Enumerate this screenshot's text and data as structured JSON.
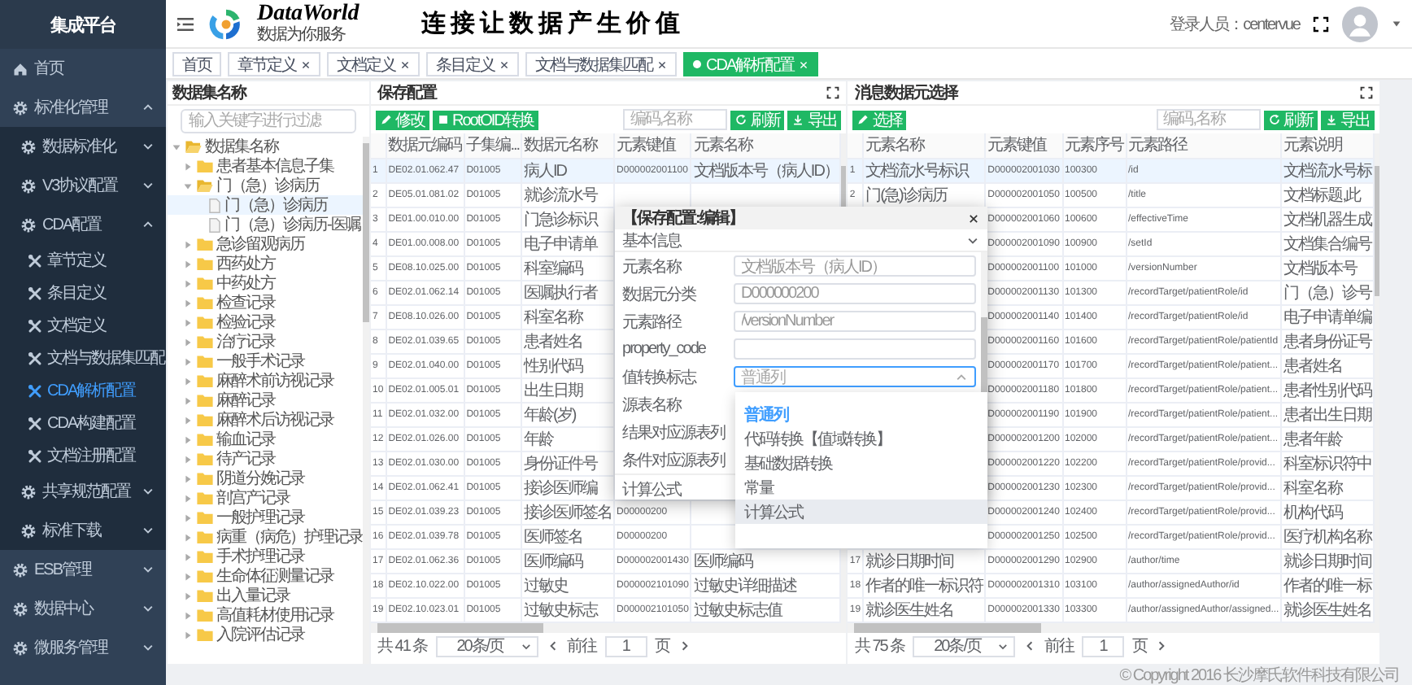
{
  "sidebar": {
    "title": "集成平台",
    "items": [
      {
        "label": "首页"
      },
      {
        "label": "标准化管理",
        "expanded": true,
        "children": [
          {
            "label": "数据标准化",
            "expanded": false
          },
          {
            "label": "V3协议配置",
            "expanded": false
          },
          {
            "label": "CDA配置",
            "expanded": true,
            "children": [
              {
                "label": "章节定义",
                "selected": false
              },
              {
                "label": "条目定义",
                "selected": false
              },
              {
                "label": "文档定义",
                "selected": false
              },
              {
                "label": "文档与数据集匹配",
                "selected": false
              },
              {
                "label": "CDA解析配置",
                "selected": true
              },
              {
                "label": "CDA构建配置",
                "selected": false
              },
              {
                "label": "文档注册配置",
                "selected": false
              }
            ]
          },
          {
            "label": "共享规范配置",
            "expanded": false
          },
          {
            "label": "标准下载",
            "expanded": false
          }
        ]
      },
      {
        "label": "ESB管理",
        "expanded": false
      },
      {
        "label": "数据中心",
        "expanded": false
      },
      {
        "label": "微服务管理",
        "expanded": false
      }
    ]
  },
  "header": {
    "logo_text": "DataWorld",
    "logo_subtitle": "数据为你服务",
    "slogan": "连接让数据产生价值",
    "user_label": "登录人员：centervue"
  },
  "tabs": [
    {
      "label": "首页",
      "closable": false,
      "selected": false
    },
    {
      "label": "章节定义",
      "closable": true,
      "selected": false
    },
    {
      "label": "文档定义",
      "closable": true,
      "selected": false
    },
    {
      "label": "条目定义",
      "closable": true,
      "selected": false
    },
    {
      "label": "文档与数据集匹配",
      "closable": true,
      "selected": false
    },
    {
      "label": "CDA解析配置",
      "closable": true,
      "selected": true
    }
  ],
  "tree_panel": {
    "title": "数据集名称",
    "search": {
      "placeholder": "输入关键字进行过滤"
    },
    "nodes": [
      {
        "label": "数据集名称",
        "kind": "folder",
        "expanded": true,
        "selected": false,
        "children": [
          {
            "label": "患者基本信息子集",
            "kind": "folder",
            "expanded": false,
            "selected": false
          },
          {
            "label": "门（急）诊病历",
            "kind": "folder",
            "expanded": true,
            "selected": false,
            "children": [
              {
                "label": "门（急）诊病历",
                "kind": "file",
                "selected": true
              },
              {
                "label": "门（急）诊病历-医嘱",
                "kind": "file",
                "selected": false
              }
            ]
          },
          {
            "label": "急诊留观病历",
            "kind": "folder",
            "expanded": false,
            "selected": false
          },
          {
            "label": "西药处方",
            "kind": "folder",
            "expanded": false,
            "selected": false
          },
          {
            "label": "中药处方",
            "kind": "folder",
            "expanded": false,
            "selected": false
          },
          {
            "label": "检查记录",
            "kind": "folder",
            "expanded": false,
            "selected": false
          },
          {
            "label": "检验记录",
            "kind": "folder",
            "expanded": false,
            "selected": false
          },
          {
            "label": "治疗记录",
            "kind": "folder",
            "expanded": false,
            "selected": false
          },
          {
            "label": "一般手术记录",
            "kind": "folder",
            "expanded": false,
            "selected": false
          },
          {
            "label": "麻醉术前访视记录",
            "kind": "folder",
            "expanded": false,
            "selected": false
          },
          {
            "label": "麻醉记录",
            "kind": "folder",
            "expanded": false,
            "selected": false
          },
          {
            "label": "麻醉术后访视记录",
            "kind": "folder",
            "expanded": false,
            "selected": false
          },
          {
            "label": "输血记录",
            "kind": "folder",
            "expanded": false,
            "selected": false
          },
          {
            "label": "待产记录",
            "kind": "folder",
            "expanded": false,
            "selected": false
          },
          {
            "label": "阴道分娩记录",
            "kind": "folder",
            "expanded": false,
            "selected": false
          },
          {
            "label": "剖宫产记录",
            "kind": "folder",
            "expanded": false,
            "selected": false
          },
          {
            "label": "一般护理记录",
            "kind": "folder",
            "expanded": false,
            "selected": false
          },
          {
            "label": "病重（病危）护理记录",
            "kind": "folder",
            "expanded": false,
            "selected": false
          },
          {
            "label": "手术护理记录",
            "kind": "folder",
            "expanded": false,
            "selected": false
          },
          {
            "label": "生命体征测量记录",
            "kind": "folder",
            "expanded": false,
            "selected": false
          },
          {
            "label": "出入量记录",
            "kind": "folder",
            "expanded": false,
            "selected": false
          },
          {
            "label": "高值耗材使用记录",
            "kind": "folder",
            "expanded": false,
            "selected": false
          },
          {
            "label": "入院评估记录",
            "kind": "folder",
            "expanded": false,
            "selected": false
          }
        ]
      }
    ]
  },
  "middle_panel": {
    "title": "保存配置",
    "buttons": [
      "修改",
      "RootOID转换"
    ],
    "search": {
      "placeholder": "编码,名称"
    },
    "actions": [
      "刷新",
      "导出"
    ],
    "columns": [
      "数据元编码",
      "子集编...",
      "数据元名称",
      "元素键值",
      "元素名称"
    ],
    "rows": [
      {
        "selected": true,
        "num": "1",
        "code": "DE02.01.062.47",
        "subset": "D01005",
        "name": "病人ID",
        "key": "D000002001100",
        "element_name": "文档版本号（病人ID）"
      },
      {
        "selected": false,
        "num": "2",
        "code": "DE05.01.081.02",
        "subset": "D01005",
        "name": "就诊流水号"
      },
      {
        "selected": false,
        "num": "3",
        "code": "DE01.00.010.00",
        "subset": "D01005",
        "name": "门急诊标识"
      },
      {
        "selected": false,
        "num": "4",
        "code": "DE01.00.008.00",
        "subset": "D01005",
        "name": "电子申请单"
      },
      {
        "selected": false,
        "num": "5",
        "code": "DE08.10.025.00",
        "subset": "D01005",
        "name": "科室编码"
      },
      {
        "selected": false,
        "num": "6",
        "code": "DE02.01.062.14",
        "subset": "D01005",
        "name": "医嘱执行者"
      },
      {
        "selected": false,
        "num": "7",
        "code": "DE08.10.026.00",
        "subset": "D01005",
        "name": "科室名称"
      },
      {
        "selected": false,
        "num": "8",
        "code": "DE02.01.039.65",
        "subset": "D01005",
        "name": "患者姓名"
      },
      {
        "selected": false,
        "num": "9",
        "code": "DE02.01.040.00",
        "subset": "D01005",
        "name": "性别代码"
      },
      {
        "selected": false,
        "num": "10",
        "code": "DE02.01.005.01",
        "subset": "D01005",
        "name": "出生日期"
      },
      {
        "selected": false,
        "num": "11",
        "code": "DE02.01.032.00",
        "subset": "D01005",
        "name": "年龄(岁)"
      },
      {
        "selected": false,
        "num": "12",
        "code": "DE02.01.026.00",
        "subset": "D01005",
        "name": "年龄"
      },
      {
        "selected": false,
        "num": "13",
        "code": "DE02.01.030.00",
        "subset": "D01005",
        "name": "身份证件号"
      },
      {
        "selected": false,
        "num": "14",
        "code": "DE02.01.062.41",
        "subset": "D01005",
        "name": "接诊医师编"
      },
      {
        "selected": false,
        "num": "15",
        "code": "DE02.01.039.23",
        "subset": "D01005",
        "name": "接诊医师签名",
        "key": "D00000200"
      },
      {
        "selected": false,
        "num": "16",
        "code": "DE02.01.039.78",
        "subset": "D01005",
        "name": "医师签名",
        "key": "D00000200"
      },
      {
        "selected": false,
        "num": "17",
        "code": "DE02.01.062.36",
        "subset": "D01005",
        "name": "医师编码",
        "key": "D000002001430",
        "element_name": "医师编码"
      },
      {
        "selected": false,
        "num": "18",
        "code": "DE02.10.022.00",
        "subset": "D01005",
        "name": "过敏史",
        "key": "D000002101090",
        "element_name": "过敏史详细描述"
      },
      {
        "selected": false,
        "num": "19",
        "code": "DE02.10.023.01",
        "subset": "D01005",
        "name": "过敏史标志",
        "key": "D000002101050",
        "element_name": "过敏史标志值"
      }
    ],
    "pagination": {
      "total": "共 41 条",
      "page_size": "20条/页",
      "goto": "前往",
      "page": "1",
      "unit": "页"
    }
  },
  "right_panel": {
    "title": "消息数据元选择",
    "buttons": [
      "选择"
    ],
    "search": {
      "placeholder": "编码,名称"
    },
    "actions": [
      "刷新",
      "导出"
    ],
    "columns": [
      "元素名称",
      "元素键值",
      "元素序号",
      "元素路径",
      "元素说明"
    ],
    "rows": [
      {
        "selected": true,
        "num": "1",
        "name": "文档流水号标识",
        "key": "D000002001030",
        "seq": "100300",
        "path": "/id",
        "desc": "文档流水号标"
      },
      {
        "selected": false,
        "num": "2",
        "name": "门(急)诊病历",
        "key": "D000002001050",
        "seq": "100500",
        "path": "/title",
        "desc": "文档标题,此"
      },
      {
        "selected": false,
        "key": "D000002001060",
        "seq": "100600",
        "path": "/effectiveTime",
        "desc": "文档机器生成"
      },
      {
        "selected": false,
        "key": "D000002001090",
        "seq": "100900",
        "path": "/setId",
        "desc": "文档集合编号"
      },
      {
        "selected": false,
        "key": "D000002001100",
        "seq": "101000",
        "path": "/versionNumber",
        "desc": "文档版本号"
      },
      {
        "selected": false,
        "key": "D000002001130",
        "seq": "101300",
        "path": "/recordTarget/patientRole/id",
        "desc": "门（急）诊号"
      },
      {
        "selected": false,
        "key": "D000002001140",
        "seq": "101400",
        "path": "/recordTarget/patientRole/id",
        "desc": "电子申请单编"
      },
      {
        "selected": false,
        "key": "D000002001160",
        "seq": "101600",
        "path": "/recordTarget/patientRole/patientId",
        "desc": "患者身份证号"
      },
      {
        "selected": false,
        "key": "D000002001170",
        "seq": "101700",
        "path": "/recordTarget/patientRole/patient...",
        "desc": "患者姓名"
      },
      {
        "selected": false,
        "key": "D000002001180",
        "seq": "101800",
        "path": "/recordTarget/patientRole/patient...",
        "desc": "患者性别代码"
      },
      {
        "selected": false,
        "key": "D000002001190",
        "seq": "101900",
        "path": "/recordTarget/patientRole/patient...",
        "desc": "患者出生日期"
      },
      {
        "selected": false,
        "key": "D000002001200",
        "seq": "102000",
        "path": "/recordTarget/patientRole/patient...",
        "desc": "患者年龄"
      },
      {
        "selected": false,
        "key": "D000002001220",
        "seq": "102200",
        "path": "/recordTarget/patientRole/provid...",
        "desc": "科室标识符中"
      },
      {
        "selected": false,
        "key": "D000002001230",
        "seq": "102300",
        "path": "/recordTarget/patientRole/provid...",
        "desc": "科室名称"
      },
      {
        "selected": false,
        "key": "D000002001240",
        "seq": "102400",
        "path": "/recordTarget/patientRole/provid...",
        "desc": "机构代码"
      },
      {
        "selected": false,
        "key": "D000002001250",
        "seq": "102500",
        "path": "/recordTarget/patientRole/provid...",
        "desc": "医疗机构名称"
      },
      {
        "selected": false,
        "num": "17",
        "name": "就诊日期时间",
        "key": "D000002001290",
        "seq": "102900",
        "path": "/author/time",
        "desc": "就诊日期时间"
      },
      {
        "selected": false,
        "num": "18",
        "name": "作者的唯一标识符",
        "key": "D000002001310",
        "seq": "103100",
        "path": "/author/assignedAuthor/id",
        "desc": "作者的唯一标"
      },
      {
        "selected": false,
        "num": "19",
        "name": "就诊医生姓名",
        "key": "D000002001330",
        "seq": "103300",
        "path": "/author/assignedAuthor/assigned...",
        "desc": "就诊医生姓名"
      }
    ],
    "pagination": {
      "total": "共 75 条",
      "page_size": "20条/页",
      "goto": "前往",
      "page": "1",
      "unit": "页"
    }
  },
  "dialog": {
    "title": "【保存配置:编辑】",
    "section": {
      "label": "基本信息",
      "expanded": true
    },
    "fields": [
      {
        "label": "元素名称",
        "kind": "input",
        "value": "文档版本号（病人ID）"
      },
      {
        "label": "数据元分类",
        "kind": "input",
        "value": "D000000200"
      },
      {
        "label": "元素路径",
        "kind": "input",
        "value": "/versionNumber"
      },
      {
        "label": "property_code",
        "kind": "input"
      },
      {
        "label": "值转换标志",
        "kind": "select",
        "placeholder": "普通列",
        "open": true
      },
      {
        "label": "源表名称",
        "kind": "label"
      },
      {
        "label": "结果对应源表列",
        "kind": "label"
      },
      {
        "label": "条件对应源表列",
        "kind": "label"
      },
      {
        "label": "计算公式",
        "kind": "label"
      }
    ],
    "dropdown": [
      {
        "label": "普通列",
        "selected": true,
        "hovered": false
      },
      {
        "label": "代码转换【值域转换】",
        "selected": false,
        "hovered": false
      },
      {
        "label": "基础数据转换",
        "selected": false,
        "hovered": false
      },
      {
        "label": "常量",
        "selected": false,
        "hovered": false
      },
      {
        "label": "计算公式",
        "selected": false,
        "hovered": true
      }
    ]
  },
  "footer": {
    "copyright": "© Copyright 2016 长沙摩氏软件科技有限公司"
  }
}
